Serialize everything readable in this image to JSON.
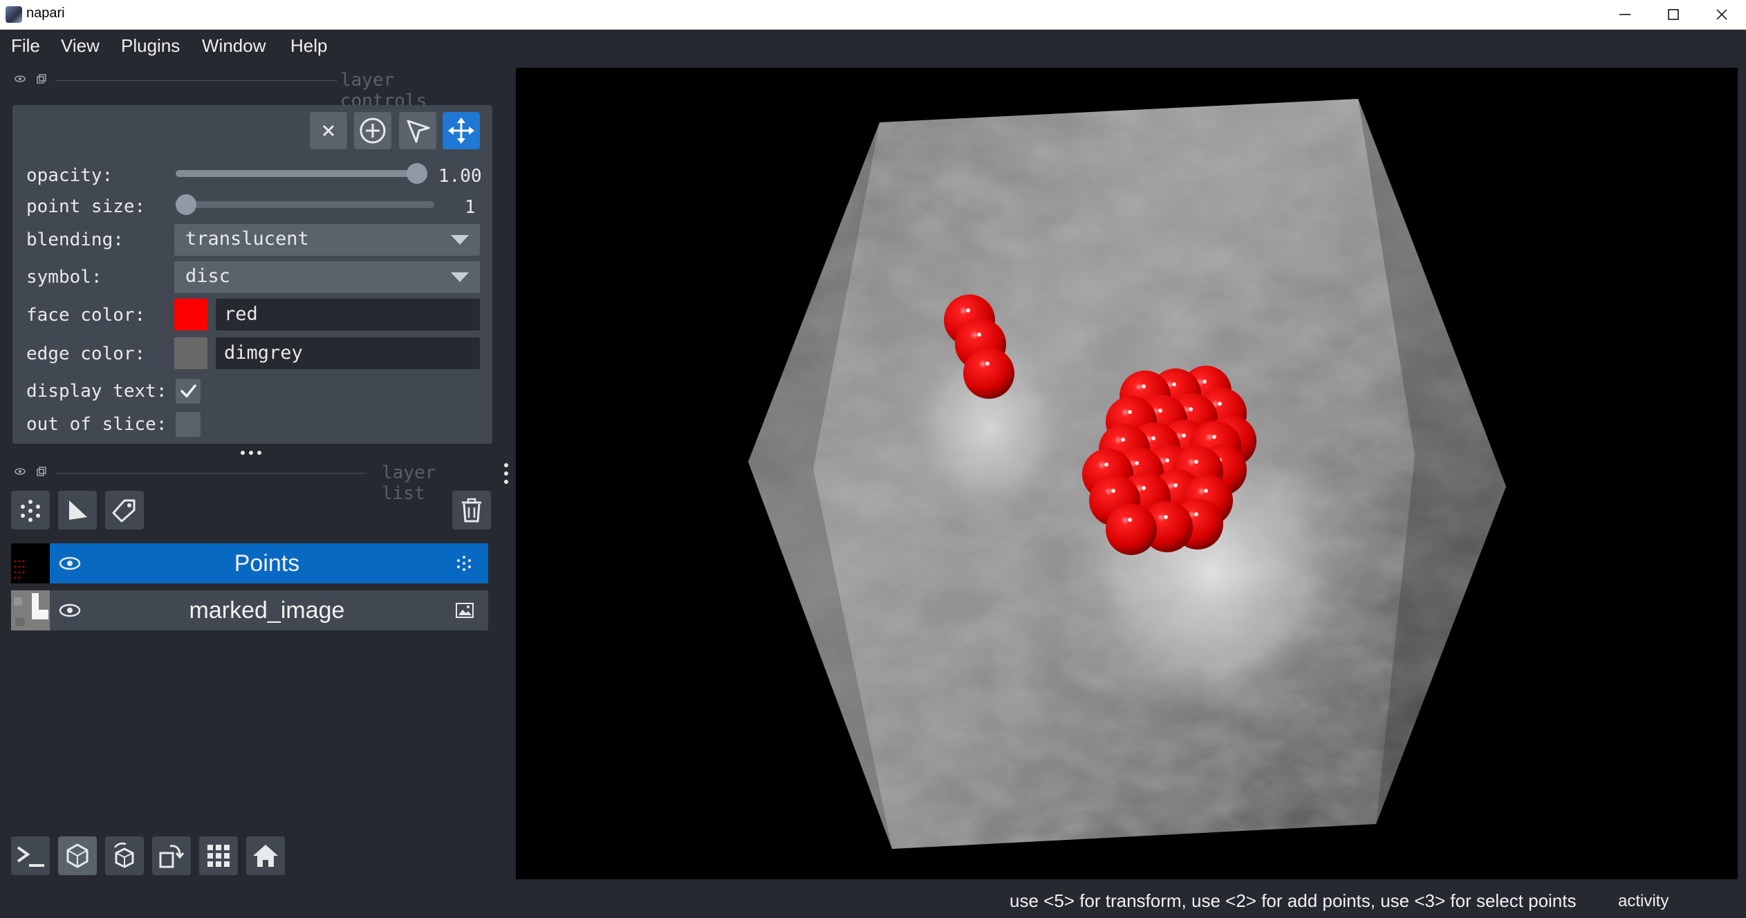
{
  "window": {
    "title": "napari"
  },
  "menu": [
    "File",
    "View",
    "Plugins",
    "Window",
    "Help"
  ],
  "layer_controls": {
    "header": "layer controls",
    "opacity_label": "opacity:",
    "opacity_value": "1.00",
    "opacity_level": 1.0,
    "point_size_label": "point size:",
    "point_size_value": "1",
    "blending_label": "blending:",
    "blending_value": "translucent",
    "symbol_label": "symbol:",
    "symbol_value": "disc",
    "face_color_label": "face color:",
    "face_color_value": "red",
    "face_color_hex": "#ff0000",
    "edge_color_label": "edge color:",
    "edge_color_value": "dimgrey",
    "edge_color_hex": "#696969",
    "display_text_label": "display text:",
    "display_text_checked": true,
    "out_of_slice_label": "out of slice:",
    "out_of_slice_checked": false,
    "mode_buttons": [
      "delete-points",
      "add-points",
      "select-points",
      "pan-zoom"
    ],
    "active_mode": "pan-zoom"
  },
  "layer_list": {
    "header": "layer list",
    "layers": [
      {
        "name": "Points",
        "selected": true,
        "visible": true,
        "type_icon": "points-icon"
      },
      {
        "name": "marked_image",
        "selected": false,
        "visible": true,
        "type_icon": "image-icon"
      }
    ]
  },
  "status": {
    "message": "use <5> for transform, use <2> for add points, use <3> for select points",
    "activity": "activity"
  },
  "colors": {
    "selected_layer": "#0869c2",
    "accent": "#1e78d4"
  }
}
